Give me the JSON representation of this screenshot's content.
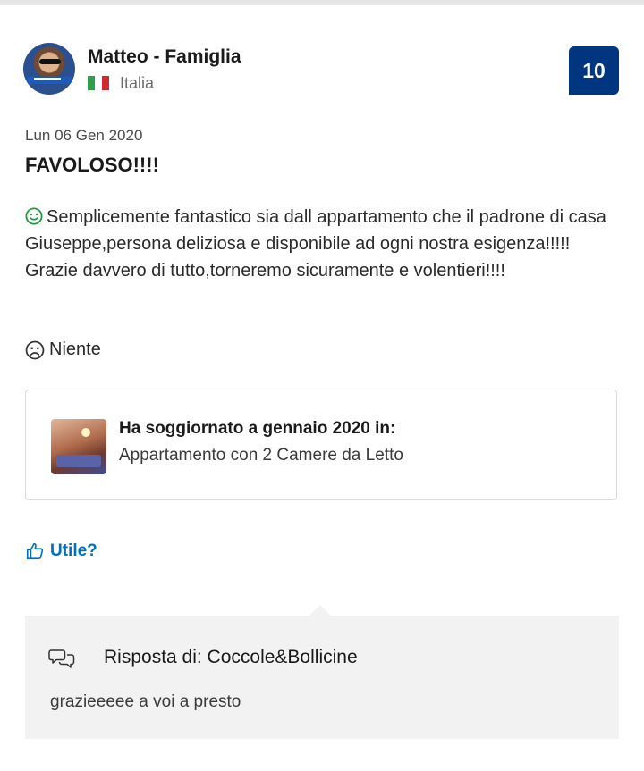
{
  "reviewer": {
    "name": "Matteo - Famiglia",
    "country": "Italia",
    "flag_colors": [
      "#2e9f4a",
      "#ffffff",
      "#d32a2f"
    ]
  },
  "review": {
    "score": "10",
    "score_color": "#003580",
    "date": "Lun 06 Gen 2020",
    "title": "FAVOLOSO!!!!",
    "positive_icon": "smile-icon",
    "positive": "Semplicemente fantastico sia dall appartamento che il padrone di casa Giuseppe,persona deliziosa e disponibile ad ogni nostra esigenza!!!!! Grazie davvero di tutto,torneremo sicuramente e volentieri!!!!",
    "negative_icon": "frown-icon",
    "negative": "Niente"
  },
  "stay": {
    "title": "Ha soggiornato a gennaio 2020 in:",
    "room": "Appartamento con 2 Camere da Letto"
  },
  "helpful": {
    "label": "Utile?",
    "icon": "thumbs-up-icon",
    "color": "#0071c2"
  },
  "reply": {
    "icon": "speech-bubbles-icon",
    "title": "Risposta di: Coccole&Bollicine",
    "text": "grazieeeee a voi a presto"
  }
}
